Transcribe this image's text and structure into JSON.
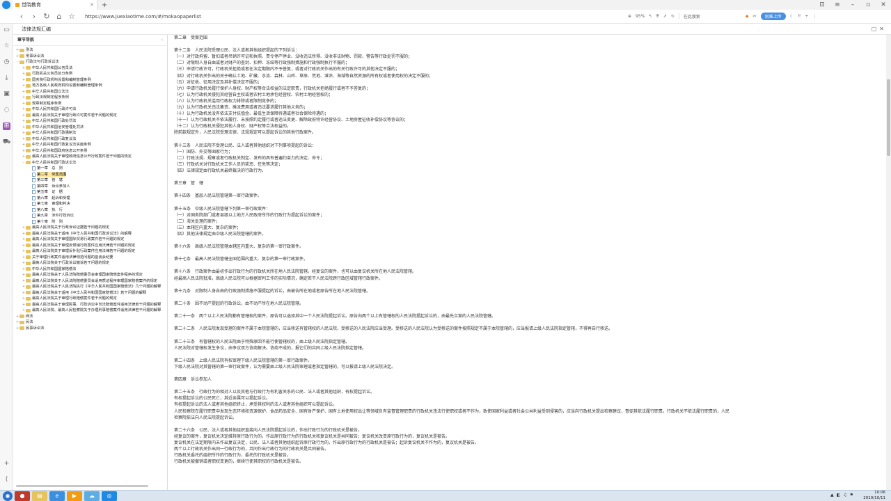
{
  "browser": {
    "tab_title": "觉晓教育",
    "url": "https://www.juexiaotime.com/#/mokaopaperlist",
    "zoom": "95%",
    "search_placeholder": "在此搜索",
    "upload_label": "别难上传"
  },
  "app": {
    "title": "法律法规汇编"
  },
  "sidebar": {
    "header": "章节导航",
    "items": [
      {
        "level": 1,
        "toggle": "+",
        "label": "刑法",
        "icon": "folder"
      },
      {
        "level": 1,
        "toggle": "+",
        "label": "刑事诉讼法",
        "icon": "folder"
      },
      {
        "level": 1,
        "toggle": "-",
        "label": "行政法与行政诉讼法",
        "icon": "folder"
      },
      {
        "level": 2,
        "toggle": "+",
        "label": "中华人民共和国公务员法",
        "icon": "folder"
      },
      {
        "level": 2,
        "toggle": "+",
        "label": "行政机关公务员处分条例",
        "icon": "folder"
      },
      {
        "level": 2,
        "toggle": "+",
        "label": "国务院行政机构设置和编制管理条例",
        "icon": "folder"
      },
      {
        "level": 2,
        "toggle": "+",
        "label": "地方各级人民政府机构设置和编制管理条例",
        "icon": "folder"
      },
      {
        "level": 2,
        "toggle": "+",
        "label": "中华人民共和国立法法",
        "icon": "folder"
      },
      {
        "level": 2,
        "toggle": "+",
        "label": "行政法规制定程序条例",
        "icon": "folder"
      },
      {
        "level": 2,
        "toggle": "+",
        "label": "规章制定程序条例",
        "icon": "folder"
      },
      {
        "level": 2,
        "toggle": "+",
        "label": "中华人民共和国行政许可法",
        "icon": "folder"
      },
      {
        "level": 2,
        "toggle": "+",
        "label": "最高人民法院关于审理行政许可案件若干问题的规定",
        "icon": "folder"
      },
      {
        "level": 2,
        "toggle": "+",
        "label": "中华人民共和国行政处罚法",
        "icon": "folder"
      },
      {
        "level": 2,
        "toggle": "+",
        "label": "中华人民共和国治安管理处罚法",
        "icon": "folder"
      },
      {
        "level": 2,
        "toggle": "+",
        "label": "中华人民共和国行政强制法",
        "icon": "folder"
      },
      {
        "level": 2,
        "toggle": "+",
        "label": "中华人民共和国行政复议法",
        "icon": "folder"
      },
      {
        "level": 2,
        "toggle": "+",
        "label": "中华人民共和国行政复议法实施条例",
        "icon": "folder"
      },
      {
        "level": 2,
        "toggle": "+",
        "label": "中华人民共和国政府信息公开条例",
        "icon": "folder"
      },
      {
        "level": 2,
        "toggle": "+",
        "label": "最高人民法院关于审理政府信息公开行政案件若干问题的规定",
        "icon": "folder"
      },
      {
        "level": 2,
        "toggle": "-",
        "label": "中华人民共和国行政诉讼法",
        "icon": "folder"
      },
      {
        "level": 3,
        "toggle": "",
        "label": "第一章　总　则",
        "icon": "doc"
      },
      {
        "level": 3,
        "toggle": "",
        "label": "第二章　受案范围",
        "icon": "doc",
        "selected": true
      },
      {
        "level": 3,
        "toggle": "",
        "label": "第三章　管　辖",
        "icon": "doc"
      },
      {
        "level": 3,
        "toggle": "",
        "label": "第四章　诉讼参加人",
        "icon": "doc"
      },
      {
        "level": 3,
        "toggle": "",
        "label": "第五章　证　据",
        "icon": "doc"
      },
      {
        "level": 3,
        "toggle": "",
        "label": "第六章　起诉和受理",
        "icon": "doc"
      },
      {
        "level": 3,
        "toggle": "",
        "label": "第七章　审理和判决",
        "icon": "doc"
      },
      {
        "level": 3,
        "toggle": "",
        "label": "第八章　执　行",
        "icon": "doc"
      },
      {
        "level": 3,
        "toggle": "",
        "label": "第九章　涉外行政诉讼",
        "icon": "doc"
      },
      {
        "level": 3,
        "toggle": "",
        "label": "第十章　附　则",
        "icon": "doc"
      },
      {
        "level": 2,
        "toggle": "+",
        "label": "最高人民法院关于行政诉讼证据若干问题的规定",
        "icon": "folder"
      },
      {
        "level": 2,
        "toggle": "+",
        "label": "最高人民法院关于适用《中华人民共和国行政诉讼法》的解释",
        "icon": "folder"
      },
      {
        "level": 2,
        "toggle": "+",
        "label": "最高人民法院关于审理国际贸易行政案件若干问题的规定",
        "icon": "folder"
      },
      {
        "level": 2,
        "toggle": "+",
        "label": "最高人民法院关于审理反倾销行政案件应用法律若干问题的规定",
        "icon": "folder"
      },
      {
        "level": 2,
        "toggle": "+",
        "label": "最高人民法院关于审理反补贴行政案件应用法律若干问题的规定",
        "icon": "folder"
      },
      {
        "level": 2,
        "toggle": "+",
        "label": "关于审理行政案件适用法律规范问题的座谈会纪要",
        "icon": "folder"
      },
      {
        "level": 2,
        "toggle": "+",
        "label": "最高人民法院关于行政诉讼撤诉若干问题的规定",
        "icon": "folder"
      },
      {
        "level": 2,
        "toggle": "+",
        "label": "中华人民共和国国家赔偿法",
        "icon": "folder"
      },
      {
        "level": 2,
        "toggle": "+",
        "label": "最高人民法院关于人民法院赔偿委员会审理国家赔偿案件程序的规定",
        "icon": "folder"
      },
      {
        "level": 2,
        "toggle": "+",
        "label": "最高人民法院关于人民法院赔偿委员会适用质证程序审理国家赔偿案件的规定",
        "icon": "folder"
      },
      {
        "level": 2,
        "toggle": "+",
        "label": "最高人民法院关于人民法院执行《中华人民共和国国家赔偿法》几个问题的解释",
        "icon": "folder"
      },
      {
        "level": 2,
        "toggle": "+",
        "label": "最高人民法院关于适用《中华人民共和国国家赔偿法》若干问题的解释",
        "icon": "folder"
      },
      {
        "level": 2,
        "toggle": "+",
        "label": "最高人民法院关于审理行政赔偿案件若干问题的规定",
        "icon": "folder"
      },
      {
        "level": 2,
        "toggle": "+",
        "label": "最高人民法院关于审理民事、行政诉讼中司法赔偿案件适用法律若干问题的解释",
        "icon": "folder"
      },
      {
        "level": 2,
        "toggle": "+",
        "label": "最高人民法院、最高人民检察院关于办理刑事赔偿案件适用法律若干问题的解释",
        "icon": "folder"
      },
      {
        "level": 1,
        "toggle": "+",
        "label": "商法",
        "icon": "folder"
      },
      {
        "level": 1,
        "toggle": "+",
        "label": "民法",
        "icon": "folder"
      },
      {
        "level": 1,
        "toggle": "+",
        "label": "民事诉讼法",
        "icon": "folder"
      }
    ]
  },
  "content": {
    "lines": [
      "第二章　受案范围",
      "",
      "第十二条　人民法院受理公民、法人或者其他组织提起的下列诉讼：",
      "（一）对行政拘留、暂扣或者吊销许可证和执照、责令停产停业、没收违法所得、没收非法财物、罚款、警告等行政处罚不服的；",
      "（二）对限制人身自由或者对财产的查封、扣押、冻结等行政强制措施和行政强制执行不服的；",
      "（三）申请行政许可，行政机关拒绝或者在法定期限内不予答复，或者对行政机关作出的有关行政许可的其他决定不服的；",
      "（四）对行政机关作出的关于确认土地、矿藏、水流、森林、山岭、草原、荒地、滩涂、海域等自然资源的所有权或者使用权的决定不服的；",
      "（五）对征收、征用决定及其补偿决定不服的；",
      "（六）申请行政机关履行保护人身权、财产权等合法权益的法定职责，行政机关拒绝履行或者不予答复的；",
      "（七）认为行政机关侵犯其经营自主权或者农村土地承包经营权、农村土地经营权的；",
      "（八）认为行政机关滥用行政权力排除或者限制竞争的；",
      "（九）认为行政机关违法集资、摊派费用或者违法要求履行其他义务的；",
      "（十）认为行政机关没有依法支付抚恤金、最低生活保障待遇或者社会保险待遇的；",
      "（十一）认为行政机关不依法履行、未按照约定履行或者违法变更、解除政府特许经营协议、土地房屋征收补偿协议等协议的；",
      "（十二）认为行政机关侵犯其他人身权、财产权等合法权益的。",
      "除前款规定外，人民法院受理法律、法规规定可以提起诉讼的其他行政案件。",
      "",
      "第十三条　人民法院不受理公民、法人或者其他组织对下列事项提起的诉讼：",
      "（一）国防、外交等国家行为；",
      "（二）行政法规、规章或者行政机关制定、发布的具有普遍约束力的决定、命令；",
      "（三）行政机关对行政机关工作人员的奖惩、任免等决定；",
      "（四）法律规定由行政机关最终裁决的行政行为。",
      "",
      "第三章　管　辖",
      "",
      "第十四条　基层人民法院管辖第一审行政案件。",
      "",
      "第十五条　中级人民法院管辖下列第一审行政案件：",
      "（一）对国务院部门或者县级以上地方人民政府所作的行政行为提起诉讼的案件；",
      "（二）海关处理的案件；",
      "（三）本辖区内重大、复杂的案件；",
      "（四）其他法律规定由中级人民法院管辖的案件。",
      "",
      "第十六条　高级人民法院管辖本辖区内重大、复杂的第一审行政案件。",
      "",
      "第十七条　最高人民法院管辖全国范围内重大、复杂的第一审行政案件。",
      "",
      "第十八条　行政案件由最初作出行政行为的行政机关所在地人民法院管辖。经复议的案件，也可以由复议机关所在地人民法院管辖。",
      "经最高人民法院批准，高级人民法院可以根据审判工作的实际情况，确定若干人民法院跨行政区域管辖行政案件。",
      "",
      "第十九条　对限制人身自由的行政强制措施不服提起的诉讼，由被告所在地或者原告所在地人民法院管辖。",
      "",
      "第二十条　因不动产提起的行政诉讼，由不动产所在地人民法院管辖。",
      "",
      "第二十一条　两个以上人民法院都有管辖权的案件，原告可以选择其中一个人民法院提起诉讼。原告向两个以上有管辖权的人民法院提起诉讼的，由最先立案的人民法院管辖。",
      "",
      "第二十二条　人民法院发现受理的案件不属于本院管辖的，应当移送有管辖权的人民法院，受移送的人民法院应当受理。受移送的人民法院认为受移送的案件按照规定不属于本院管辖的，应当报请上级人民法院指定管辖，不得再自行移送。",
      "",
      "第二十三条　有管辖权的人民法院由于特殊原因不能行使管辖权的，由上级人民法院指定管辖。",
      "人民法院对管辖权发生争议，由争议双方协商解决。协商不成的，报它们的共同上级人民法院指定管辖。",
      "",
      "第二十四条　上级人民法院有权审理下级人民法院管辖的第一审行政案件。",
      "下级人民法院对其管辖的第一审行政案件，认为需要由上级人民法院审理或者指定管辖的，可以报请上级人民法院决定。",
      "",
      "第四章　诉讼参加人",
      "",
      "第二十五条　行政行为的相对人以及其他与行政行为有利害关系的公民、法人或者其他组织，有权提起诉讼。",
      "有权提起诉讼的公民死亡，其近亲属可以提起诉讼。",
      "有权提起诉讼的法人或者其他组织终止，承受其权利的法人或者其他组织可以提起诉讼。",
      "人民检察院在履行职责中发现生态环境和资源保护、食品药品安全、国有财产保护、国有土地使用权出让等领域负有监督管理职责的行政机关违法行使职权或者不作为，致使国家利益或者社会公共利益受到侵害的，应当向行政机关提出检察建议，督促其依法履行职责。行政机关不依法履行职责的，人民",
      "检察院依法向人民法院提起诉讼。",
      "",
      "第二十六条　公民、法人或者其他组织直接向人民法院提起诉讼的，作出行政行为的行政机关是被告。",
      "经复议的案件，复议机关决定维持原行政行为的，作出原行政行为的行政机关和复议机关是共同被告；复议机关改变原行政行为的，复议机关是被告。",
      "复议机关在法定期限内未作出复议决定，公民、法人或者其他组织起诉原行政行为的，作出原行政行为的行政机关是被告；起诉复议机关不作为的，复议机关是被告。",
      "两个以上行政机关作出同一行政行为的，共同作出行政行为的行政机关是共同被告。",
      "行政机关委托的组织所作的行政行为，委托的行政机关是被告。",
      "行政机关被撤销或者职权变更的，继续行使其职权的行政机关是被告。"
    ]
  },
  "taskbar": {
    "time": "10:06",
    "date": "2019/10/11"
  }
}
